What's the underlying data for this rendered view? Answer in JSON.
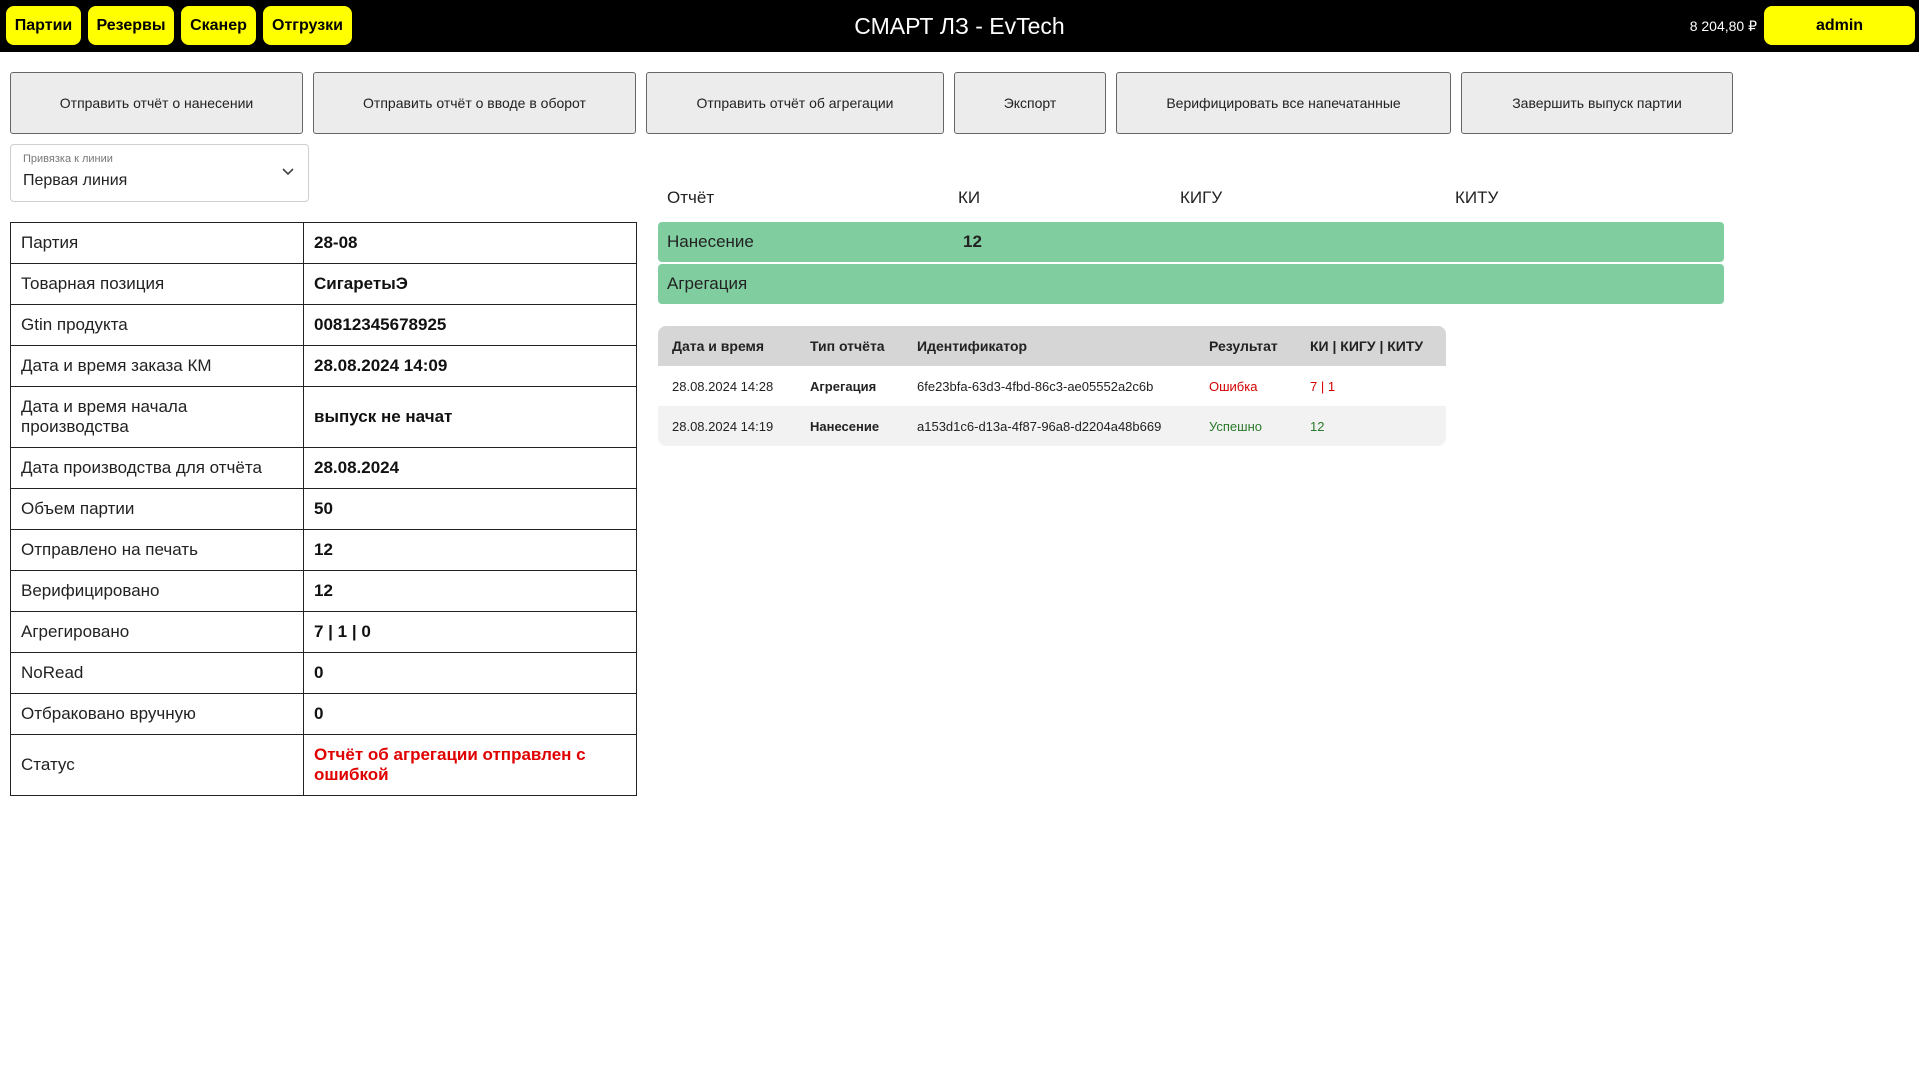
{
  "nav": {
    "items": [
      "Партии",
      "Резервы",
      "Сканер",
      "Отгрузки"
    ]
  },
  "header": {
    "title": "СМАРТ ЛЗ - EvTech",
    "balance": "8 204,80 ₽",
    "user": "admin"
  },
  "actions": [
    "Отправить отчёт о нанесении",
    "Отправить отчёт о вводе в оборот",
    "Отправить отчёт об агрегации",
    "Экспорт",
    "Верифицировать все напечатанные",
    "Завершить выпуск партии"
  ],
  "line_select": {
    "label": "Привязка к линии",
    "value": "Первая линия"
  },
  "info": [
    {
      "key": "Партия",
      "value": "28-08"
    },
    {
      "key": "Товарная позиция",
      "value": "СигаретыЭ"
    },
    {
      "key": "Gtin продукта",
      "value": "00812345678925"
    },
    {
      "key": "Дата и время заказа КМ",
      "value": "28.08.2024 14:09"
    },
    {
      "key": "Дата и время начала производства",
      "value": "выпуск не начат"
    },
    {
      "key": "Дата производства для отчёта",
      "value": "28.08.2024"
    },
    {
      "key": "Объем партии",
      "value": "50"
    },
    {
      "key": "Отправлено на печать",
      "value": "12"
    },
    {
      "key": "Верифицировано",
      "value": "12"
    },
    {
      "key": "Агрегировано",
      "value": "7 | 1 | 0"
    },
    {
      "key": "NoRead",
      "value": "0"
    },
    {
      "key": "Отбраковано вручную",
      "value": "0"
    },
    {
      "key": "Статус",
      "value": "Отчёт об агрегации отправлен с ошибкой"
    }
  ],
  "summary": {
    "headers": {
      "report": "Отчёт",
      "ki": "КИ",
      "kigu": "КИГУ",
      "kitu": "КИТУ"
    },
    "rows": [
      {
        "label": "Нанесение",
        "ki": "12"
      },
      {
        "label": "Агрегация",
        "ki": ""
      }
    ]
  },
  "log": {
    "headers": {
      "datetime": "Дата и время",
      "type": "Тип отчёта",
      "id": "Идентификатор",
      "result": "Результат",
      "counts": "КИ | КИГУ | КИТУ"
    },
    "rows": [
      {
        "datetime": "28.08.2024 14:28",
        "type": "Агрегация",
        "id": "6fe23bfa-63d3-4fbd-86c3-ae05552a2c6b",
        "result": "Ошибка",
        "counts": "7 | 1"
      },
      {
        "datetime": "28.08.2024 14:19",
        "type": "Нанесение",
        "id": "a153d1c6-d13a-4f87-96a8-d2204a48b669",
        "result": "Успешно",
        "counts": "12"
      }
    ]
  },
  "colors": {
    "accent": "#ffff00",
    "topbar": "#000000",
    "summary_row": "#80cea0",
    "error": "#e00000",
    "success": "#2a7a2a"
  }
}
